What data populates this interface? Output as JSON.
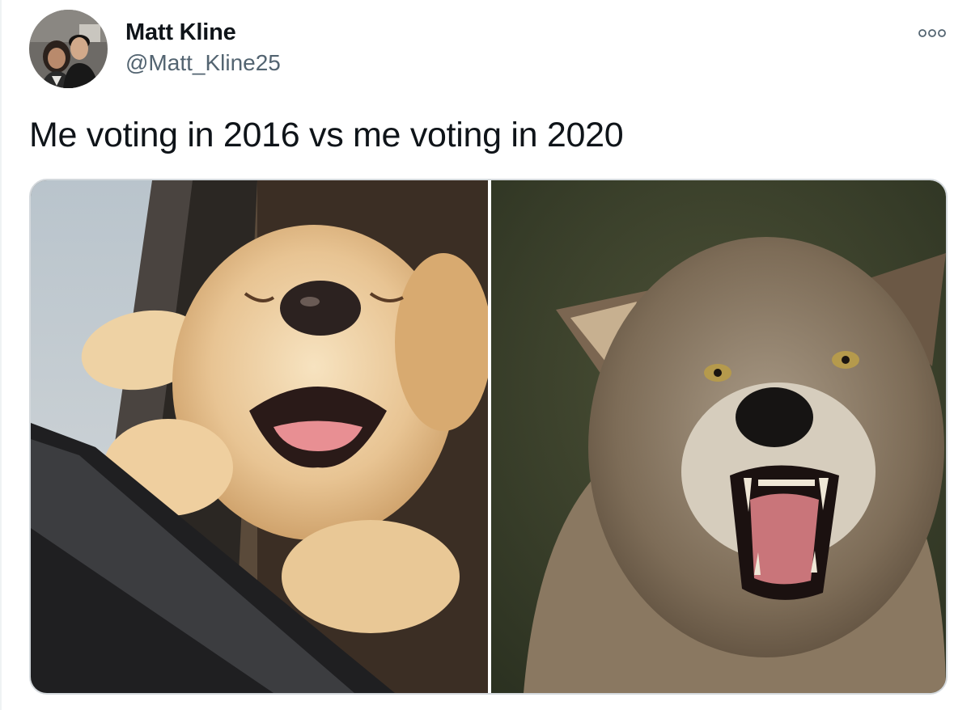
{
  "tweet": {
    "display_name": "Matt Kline",
    "handle": "@Matt_Kline25",
    "text": "Me voting in 2016 vs me voting in 2020"
  },
  "icons": {
    "more": "more-horizontal-icon",
    "avatar": "avatar"
  },
  "colors": {
    "name": "#0f1419",
    "handle": "#536471",
    "border": "#d4d9dd"
  }
}
